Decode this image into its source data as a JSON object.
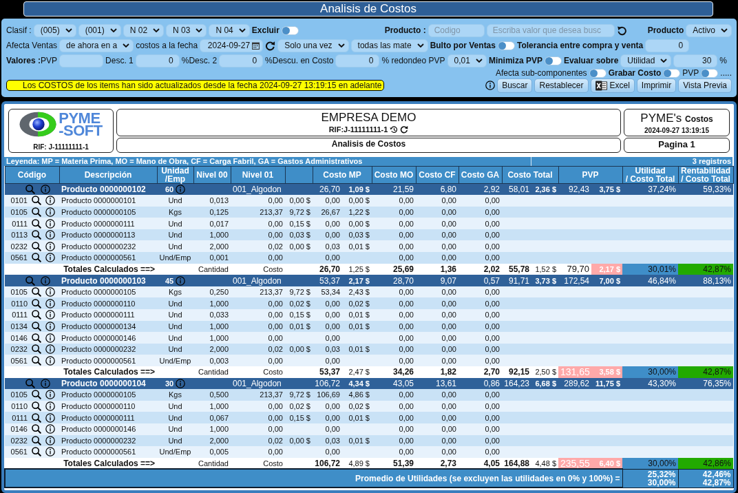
{
  "window": {
    "title": "Analisis de Costos"
  },
  "filters": {
    "rows": [
      {
        "left": [
          {
            "kind": "label",
            "text": "Clasif :",
            "bold": false
          },
          {
            "kind": "select",
            "value": "(005)"
          },
          {
            "kind": "select",
            "value": "(001)"
          },
          {
            "kind": "select",
            "value": "N 02"
          },
          {
            "kind": "select",
            "value": "N 03"
          },
          {
            "kind": "select",
            "value": "N 04"
          },
          {
            "kind": "label",
            "text": "Excluir",
            "bold": true
          },
          {
            "kind": "toggle",
            "on": false
          }
        ],
        "middle": [
          {
            "kind": "label",
            "text": "Producto :",
            "bold": true
          },
          {
            "kind": "input",
            "placeholder": "Codigo"
          },
          {
            "kind": "input",
            "placeholder": "Escriba valor que desea busc"
          },
          {
            "kind": "reset_button"
          }
        ],
        "right": [
          {
            "kind": "label",
            "text": "Producto",
            "bold": true
          },
          {
            "kind": "select",
            "value": "Activo"
          }
        ]
      },
      {
        "left": [
          {
            "kind": "label",
            "text": "Afecta Ventas",
            "bold": false
          },
          {
            "kind": "select",
            "value": "de ahora en a"
          },
          {
            "kind": "label",
            "text": "costos a la fecha",
            "bold": false
          },
          {
            "kind": "date",
            "value": "2024-09-27"
          },
          {
            "kind": "refresh_button"
          },
          {
            "kind": "select",
            "value": "Solo una vez"
          },
          {
            "kind": "select",
            "value": "todas las mate"
          },
          {
            "kind": "label",
            "text": "Bulto por Ventas",
            "bold": true
          },
          {
            "kind": "toggle",
            "on": false
          },
          {
            "kind": "label",
            "text": "Tolerancia entre compra y venta",
            "bold": true
          },
          {
            "kind": "input",
            "value": "0"
          }
        ]
      },
      {
        "left": [
          {
            "kind": "label",
            "text": "**Valores :**PVP",
            "bold": false
          },
          {
            "kind": "input"
          },
          {
            "kind": "label",
            "text": "Desc. 1",
            "bold": false
          },
          {
            "kind": "input",
            "value": "0"
          },
          {
            "kind": "label",
            "text": "%Desc. 2",
            "bold": false
          },
          {
            "kind": "input",
            "value": "0"
          },
          {
            "kind": "label",
            "text": "%Descu. en Costo",
            "bold": false
          },
          {
            "kind": "input",
            "value": "0"
          },
          {
            "kind": "label",
            "text": "% redondeo PVP",
            "bold": false
          },
          {
            "kind": "select",
            "value": "0,01"
          },
          {
            "kind": "label",
            "text": "Minimiza PVP",
            "bold": true
          },
          {
            "kind": "toggle",
            "on": false
          },
          {
            "kind": "label",
            "text": "Evaluar sobre",
            "bold": true
          },
          {
            "kind": "select",
            "value": "Utilidad"
          },
          {
            "kind": "input",
            "value": "30"
          },
          {
            "kind": "label",
            "text": "%",
            "bold": false
          }
        ]
      },
      {
        "right": [
          {
            "kind": "label",
            "text": "Afecta sub-componentes",
            "bold": false
          },
          {
            "kind": "toggle",
            "on": false
          },
          {
            "kind": "label",
            "text": "Grabar Costo",
            "bold": true
          },
          {
            "kind": "toggle",
            "on": false
          },
          {
            "kind": "label",
            "text": "PVP",
            "bold": false
          },
          {
            "kind": "toggle",
            "on": false
          },
          {
            "kind": "label",
            "text": ".....",
            "bold": false
          }
        ]
      },
      {
        "left": [
          {
            "kind": "notice",
            "text": "Los COSTOS de los items han sido actualizados desde la fecha 2024-09-27 13:19:15 en adelante"
          }
        ],
        "right": [
          {
            "kind": "info_button"
          },
          {
            "kind": "button",
            "text": "Buscar"
          },
          {
            "kind": "button",
            "text": "Restablecer"
          },
          {
            "kind": "excel_button",
            "text": "Excel"
          },
          {
            "kind": "button",
            "text": "Imprimir"
          },
          {
            "kind": "button",
            "text": "Vista Previa"
          }
        ]
      }
    ]
  },
  "report": {
    "header": {
      "logo_lines": [
        "PYME",
        "-SOFT"
      ],
      "logo_rif": "RIF: J-11111111-1",
      "company": "EMPRESA DEMO",
      "company_rif": "RIF:J-11111111-1",
      "report_title": "Analisis de Costos",
      "brand": "PYME's **Costos**",
      "timestamp": "2024-09-27 13:19:15",
      "page": "Pagina 1"
    },
    "legend": "Leyenda: MP = Materia Prima, MO = Mano de Obra, CF = Carga Fabril, GA = Gastos Administrativos",
    "record_count": "3 registros",
    "table": {
      "columns": [
        "Código",
        "Descripción",
        "Unidad\n/Emp",
        "Nivel 00",
        "Nivel 01",
        "Costo MP",
        "Costo MO",
        "Costo CF",
        "Costo GA",
        "Costo Total",
        "PVP",
        "Utilidad\n/ Costo Total",
        "Rentabilidad\n/ Costo Total"
      ],
      "groups": [
        {
          "product": {
            "description": "Producto 0000000102",
            "quantity": "60",
            "nivel_01": "001_Algodon",
            "cost_mp": "26,70",
            "cost_mp_usd": "1,09 $",
            "cost_mo": "21,59",
            "cost_cf": "6,80",
            "cost_ga": "2,92",
            "cost_total": "58,01",
            "cost_total_usd": "2,36 $",
            "pvp": "92,43",
            "pvp_usd": "3,75 $",
            "utility": "37,24%",
            "profitability": "59,33%"
          },
          "items": [
            {
              "code": "0101",
              "description": "Producto 0000000101",
              "unit": "Und",
              "nivel_00": "0,013",
              "nivel_01": "0,00",
              "column_6": "0,00 $",
              "cost_mp": "0,00",
              "cost_mp_usd": "0,00 $",
              "cost_mo": "0,00",
              "cost_cf": "0,00",
              "cost_ga": "0,00"
            },
            {
              "code": "0105",
              "description": "Producto 0000000105",
              "unit": "Kgs",
              "nivel_00": "0,125",
              "nivel_01": "213,37",
              "column_6": "9,72 $",
              "cost_mp": "26,67",
              "cost_mp_usd": "1,22 $",
              "cost_mo": "0,00",
              "cost_cf": "0,00",
              "cost_ga": "0,00"
            },
            {
              "code": "0111",
              "description": "Producto 0000000111",
              "unit": "Und",
              "nivel_00": "0,017",
              "nivel_01": "0,00",
              "column_6": "0,15 $",
              "cost_mp": "0,00",
              "cost_mp_usd": "0,00 $",
              "cost_mo": "0,00",
              "cost_cf": "0,00",
              "cost_ga": "0,00"
            },
            {
              "code": "0113",
              "description": "Producto 0000000113",
              "unit": "Und",
              "nivel_00": "1,000",
              "nivel_01": "0,00",
              "column_6": "0,03 $",
              "cost_mp": "0,00",
              "cost_mp_usd": "0,03 $",
              "cost_mo": "0,00",
              "cost_cf": "0,00",
              "cost_ga": "0,00"
            },
            {
              "code": "0232",
              "description": "Producto 0000000232",
              "unit": "Und",
              "nivel_00": "2,000",
              "nivel_01": "0,02",
              "column_6": "0,00 $",
              "cost_mp": "0,03",
              "cost_mp_usd": "0,01 $",
              "cost_mo": "0,00",
              "cost_cf": "0,00",
              "cost_ga": "0,00"
            },
            {
              "code": "0561",
              "description": "Producto 0000000561",
              "unit": "Und/Emp",
              "nivel_00": "0,001",
              "nivel_01": "0,00",
              "cost_mp": "0,00",
              "cost_mo": "0,00",
              "cost_cf": "0,00",
              "cost_ga": "0,00"
            }
          ],
          "totals": {
            "label": "Totales Calculados ==>",
            "nivel_00": "Cantidad",
            "nivel_01": "Costo",
            "cost_mp": "26,70",
            "cost_mp_usd": "1,25 $",
            "cost_mo": "25,69",
            "cost_cf": "1,36",
            "cost_ga": "2,02",
            "cost_total": "55,78",
            "cost_total_usd": "1,52 $",
            "pvp": {
              "text": "79,70",
              "alert": false
            },
            "pvp_usd": {
              "text": "2,17 $",
              "alert": true
            },
            "utility": "30,01%",
            "profitability": "42,87%"
          }
        },
        {
          "product": {
            "description": "Producto 0000000103",
            "quantity": "45",
            "nivel_01": "001_Algodon",
            "cost_mp": "53,37",
            "cost_mp_usd": "2,17 $",
            "cost_mo": "28,70",
            "cost_cf": "9,07",
            "cost_ga": "0,57",
            "cost_total": "91,71",
            "cost_total_usd": "3,73 $",
            "pvp": "172,54",
            "pvp_usd": "7,00 $",
            "utility": "46,84%",
            "profitability": "88,13%"
          },
          "items": [
            {
              "code": "0105",
              "description": "Producto 0000000105",
              "unit": "Kgs",
              "nivel_00": "0,250",
              "nivel_01": "213,37",
              "column_6": "9,72 $",
              "cost_mp": "53,34",
              "cost_mp_usd": "2,43 $",
              "cost_mo": "0,00",
              "cost_cf": "0,00",
              "cost_ga": "0,00"
            },
            {
              "code": "0110",
              "description": "Producto 0000000110",
              "unit": "Und",
              "nivel_00": "1,000",
              "nivel_01": "0,00",
              "column_6": "0,02 $",
              "cost_mp": "0,00",
              "cost_mp_usd": "0,02 $",
              "cost_mo": "0,00",
              "cost_cf": "0,00",
              "cost_ga": "0,00"
            },
            {
              "code": "0111",
              "description": "Producto 0000000111",
              "unit": "Und",
              "nivel_00": "0,033",
              "nivel_01": "0,00",
              "column_6": "0,15 $",
              "cost_mp": "0,00",
              "cost_mp_usd": "0,01 $",
              "cost_mo": "0,00",
              "cost_cf": "0,00",
              "cost_ga": "0,00"
            },
            {
              "code": "0134",
              "description": "Producto 0000000134",
              "unit": "Und",
              "nivel_00": "1,000",
              "nivel_01": "0,00",
              "column_6": "0,01 $",
              "cost_mp": "0,00",
              "cost_mp_usd": "0,01 $",
              "cost_mo": "0,00",
              "cost_cf": "0,00",
              "cost_ga": "0,00"
            },
            {
              "code": "0146",
              "description": "Producto 0000000146",
              "unit": "Und",
              "nivel_00": "1,000",
              "nivel_01": "0,00",
              "cost_mp": "0,00",
              "cost_mo": "0,00",
              "cost_cf": "0,00",
              "cost_ga": "0,00"
            },
            {
              "code": "0232",
              "description": "Producto 0000000232",
              "unit": "Und",
              "nivel_00": "2,000",
              "nivel_01": "0,02",
              "column_6": "0,00 $",
              "cost_mp": "0,03",
              "cost_mp_usd": "0,01 $",
              "cost_mo": "0,00",
              "cost_cf": "0,00",
              "cost_ga": "0,00"
            },
            {
              "code": "0561",
              "description": "Producto 0000000561",
              "unit": "Und/Emp",
              "nivel_00": "0,003",
              "nivel_01": "0,00",
              "cost_mp": "0,00",
              "cost_mo": "0,00",
              "cost_cf": "0,00",
              "cost_ga": "0,00"
            }
          ],
          "totals": {
            "label": "Totales Calculados ==>",
            "nivel_00": "Cantidad",
            "nivel_01": "Costo",
            "cost_mp": "53,37",
            "cost_mp_usd": "2,47 $",
            "cost_mo": "34,26",
            "cost_cf": "1,82",
            "cost_ga": "2,70",
            "cost_total": "92,15",
            "cost_total_usd": "2,50 $",
            "pvp": {
              "text": "131,65",
              "alert": true
            },
            "pvp_usd": {
              "text": "3,58 $",
              "alert": true
            },
            "utility": "30,00%",
            "profitability": "42,87%"
          }
        },
        {
          "product": {
            "description": "Producto 0000000104",
            "quantity": "30",
            "nivel_01": "001_Algodon",
            "cost_mp": "106,72",
            "cost_mp_usd": "4,34 $",
            "cost_mo": "43,05",
            "cost_cf": "13,61",
            "cost_ga": "0,86",
            "cost_total": "164,23",
            "cost_total_usd": "6,68 $",
            "pvp": "289,62",
            "pvp_usd": "11,75 $",
            "utility": "43,30%",
            "profitability": "76,35%"
          },
          "items": [
            {
              "code": "0105",
              "description": "Producto 0000000105",
              "unit": "Kgs",
              "nivel_00": "0,500",
              "nivel_01": "213,37",
              "column_6": "9,72 $",
              "cost_mp": "106,69",
              "cost_mp_usd": "4,86 $",
              "cost_mo": "0,00",
              "cost_cf": "0,00",
              "cost_ga": "0,00"
            },
            {
              "code": "0110",
              "description": "Producto 0000000110",
              "unit": "Und",
              "nivel_00": "1,000",
              "nivel_01": "0,00",
              "column_6": "0,02 $",
              "cost_mp": "0,00",
              "cost_mp_usd": "0,02 $",
              "cost_mo": "0,00",
              "cost_cf": "0,00",
              "cost_ga": "0,00"
            },
            {
              "code": "0111",
              "description": "Producto 0000000111",
              "unit": "Und",
              "nivel_00": "0,067",
              "nivel_01": "0,00",
              "column_6": "0,15 $",
              "cost_mp": "0,00",
              "cost_mp_usd": "0,01 $",
              "cost_mo": "0,00",
              "cost_cf": "0,00",
              "cost_ga": "0,00"
            },
            {
              "code": "0146",
              "description": "Producto 0000000146",
              "unit": "Und",
              "nivel_00": "1,000",
              "nivel_01": "0,00",
              "cost_mp": "0,00",
              "cost_mo": "0,00",
              "cost_cf": "0,00",
              "cost_ga": "0,00"
            },
            {
              "code": "0232",
              "description": "Producto 0000000232",
              "unit": "Und",
              "nivel_00": "2,000",
              "nivel_01": "0,02",
              "column_6": "0,00 $",
              "cost_mp": "0,03",
              "cost_mp_usd": "0,01 $",
              "cost_mo": "0,00",
              "cost_cf": "0,00",
              "cost_ga": "0,00"
            },
            {
              "code": "0561",
              "description": "Producto 0000000561",
              "unit": "Und/Emp",
              "nivel_00": "0,005",
              "nivel_01": "0,00",
              "cost_mp": "0,00",
              "cost_mo": "0,00",
              "cost_cf": "0,00",
              "cost_ga": "0,00"
            }
          ],
          "totals": {
            "label": "Totales Calculados ==>",
            "nivel_00": "Cantidad",
            "nivel_01": "Costo",
            "cost_mp": "106,72",
            "cost_mp_usd": "4,89 $",
            "cost_mo": "51,39",
            "cost_cf": "2,73",
            "cost_ga": "4,05",
            "cost_total": "164,88",
            "cost_total_usd": "4,48 $",
            "pvp": {
              "text": "235,55",
              "alert": true
            },
            "pvp_usd": {
              "text": "6,40 $",
              "alert": true
            },
            "utility": "30,00%",
            "profitability": "42,86%"
          }
        }
      ],
      "footer": {
        "label": "Promedio de Utilidades (se excluyen las utilidades en 0% y 100%) =",
        "utility": [
          "25,32%",
          "30,00%"
        ],
        "profitability": [
          "42,46%",
          "42,87%"
        ]
      }
    }
  }
}
